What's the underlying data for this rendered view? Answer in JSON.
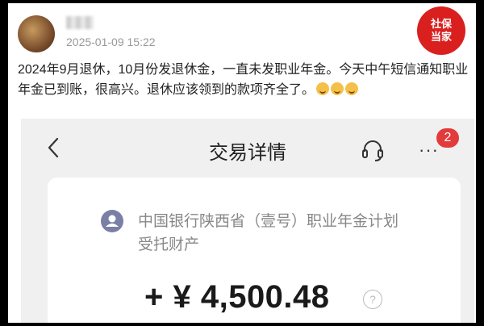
{
  "post": {
    "username": "清清",
    "timestamp": "2025-01-09 15:22",
    "text": "2024年9月退休，10月份发退休金，一直未发职业年金。今天中午短信通知职业年金已到账，很高兴。退休应该领到的款项齐全了。",
    "emojis": [
      "grin-emoji",
      "grin-emoji",
      "grin-emoji"
    ]
  },
  "badge": {
    "line1": "社保",
    "line2": "当家"
  },
  "screenshot": {
    "title": "交易详情",
    "notification_count": "2",
    "more_label": "···",
    "payee": "中国银行陕西省（壹号）职业年金计划受托财产",
    "amount": "+ ¥ 4,500.48",
    "help_symbol": "?"
  },
  "colors": {
    "badge_red": "#d9201f",
    "notify_red": "#e33b3b",
    "screen_bg": "#f0f0f0"
  }
}
